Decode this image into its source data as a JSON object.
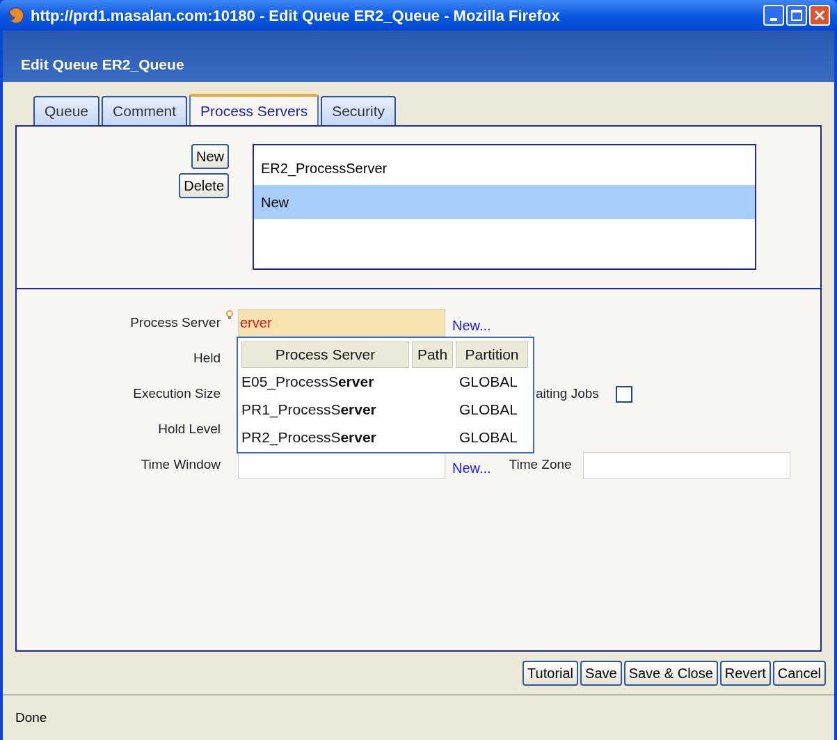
{
  "window": {
    "title": "http://prd1.masalan.com:10180 - Edit Queue ER2_Queue - Mozilla Firefox"
  },
  "dialog": {
    "title": "Edit Queue ER2_Queue"
  },
  "tabs": [
    {
      "label": "Queue",
      "selected": false
    },
    {
      "label": "Comment",
      "selected": false
    },
    {
      "label": "Process Servers",
      "selected": true
    },
    {
      "label": "Security",
      "selected": false
    }
  ],
  "server_list": {
    "buttons": [
      "New",
      "Delete"
    ],
    "items": [
      {
        "label": "ER2_ProcessServer",
        "selected": false
      },
      {
        "label": "New",
        "selected": true
      }
    ]
  },
  "form": {
    "process_server": {
      "label": "Process Server",
      "value": "erver",
      "link": "New..."
    },
    "held": {
      "label": "Held"
    },
    "execution_size": {
      "label": "Execution Size"
    },
    "waiting_jobs": {
      "label": "aiting Jobs",
      "checked": false
    },
    "hold_level": {
      "label": "Hold Level"
    },
    "time_window": {
      "label": "Time Window",
      "link": "New..."
    },
    "time_zone": {
      "label": "Time Zone"
    }
  },
  "suggestions": {
    "columns": [
      "Process Server",
      "Path",
      "Partition"
    ],
    "rows": [
      {
        "process_server": "E05_ProcessS**erver**",
        "partition": "GLOBAL"
      },
      {
        "process_server": "PR1_ProcessS**erver**",
        "partition": "GLOBAL"
      },
      {
        "process_server": "PR2_ProcessS**erver**",
        "partition": "GLOBAL"
      }
    ]
  },
  "buttons": [
    "Tutorial",
    "Save",
    "Save & Close",
    "Revert",
    "Cancel"
  ],
  "status_bar": "Done"
}
